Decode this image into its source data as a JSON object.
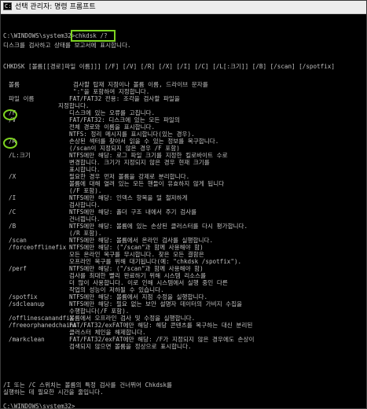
{
  "window": {
    "title": "선택 관리자: 명령 프롬프트",
    "icon": "cmd-icon"
  },
  "console": {
    "command_line": {
      "prompt": "C:\\WINDOWS\\system32>",
      "command": "chkdsk /?"
    },
    "intro": "디스크를 검사하고 상태를 보고서에 표시합니다.",
    "usage": "CHKDSK [볼륨[[경로]파일 이름]]] [/F] [/V] [/R] [/X] [/I] [/C] [/L[:크기]] [/B] [/scan] [/spotfix]",
    "options": [
      {
        "flag": "볼륨",
        "lines": [
          "검사할 탑재 지점이나 볼륨 이름, 드라이브 문자를",
          "\":\"을 포함하여 지정합니다."
        ]
      },
      {
        "flag": "파일 이름",
        "lines": [
          "FAT/FAT32 전용: 조각을 검사할 파일을",
          "지정합니다."
        ]
      },
      {
        "flag": "/F",
        "lines": [
          "디스크에 있는 오류를 고칩니다."
        ]
      },
      {
        "flag": "/V",
        "lines": [
          "FAT/FAT32: 디스크에 있는 모든 파일의",
          "전체 경로와 이름을 표시합니다.",
          "NTFS: 정리 메시지를 표시합니다(있는 경우)."
        ]
      },
      {
        "flag": "/R",
        "lines": [
          "손상된 섹터를 찾아서 읽을 수 있는 정보를 복구합니다.",
          "(/scan이 지정되지 않은 경우 /F 포함)"
        ]
      },
      {
        "flag": "/L:크기",
        "lines": [
          "NTFS에만 해당: 로그 파일 크기를 지정한 킬로바이트 수로",
          "변경합니다. 크기가 지정되지 않은 경우 현재 크기를",
          "표시합니다."
        ]
      },
      {
        "flag": "/X",
        "lines": [
          "필요한 경우 먼저 볼륨을 강제로 분리합니다.",
          "볼륨에 대해 열려 있는 모든 핸들이 유효하지 않게 됩니다",
          "(/F 포함)."
        ]
      },
      {
        "flag": "/I",
        "lines": [
          "NTFS에만 해당: 인덱스 항목을 덜 철저하게",
          "검사합니다."
        ]
      },
      {
        "flag": "/C",
        "lines": [
          "NTFS에만 해당: 폴더 구조 내에서 주기 검사를",
          "건너뜁니다."
        ]
      },
      {
        "flag": "/B",
        "lines": [
          "NTFS에만 해당: 볼륨에 있는 손상된 클러스터를 다시 평가합니다.",
          "(/R 포함)."
        ]
      },
      {
        "flag": "/scan",
        "lines": [
          "NTFS에만 해당: 볼륨에서 온라인 검사를 실행합니다."
        ]
      },
      {
        "flag": "/forceofflinefix",
        "lines": [
          "NTFS에만 해당: (\"/scan\"과 함께 사용해야 함)",
          "모든 온라인 복구를 무시합니다. 찾은 모든 결함은",
          "오프라인 복구를 위해 대기됩니다(예: \"chkdsk /spotfix\")."
        ]
      },
      {
        "flag": "/perf",
        "lines": [
          "NTFS에만 해당: (\"/scan\"과 함께 사용해야 함)",
          "검사를 최대한 빨리 완료하기 위해 시스템 리소스를",
          "더 많이 사용합니다. 이로 인해 시스템에서 실행 중인 다른",
          "작업의 성능이 저하될 수 있습니다."
        ]
      },
      {
        "flag": "/spotfix",
        "lines": [
          "NTFS에만 해당: 볼륨에서 지점 수정을 실행합니다."
        ]
      },
      {
        "flag": "/sdcleanup",
        "lines": [
          "NTFS에만 해당: 필요 없는 보안 설명자 데이터의 가비지 수집을",
          "수행합니다(/F 포함)."
        ]
      },
      {
        "flag": "/offlinescanandfix",
        "lines": [
          "볼륨에서 오프라인 검사 및 수정을 실행합니다."
        ]
      },
      {
        "flag": "/freeorphanedchains",
        "lines": [
          "FAT/FAT32/exFAT에만 해당: 해당 콘텐츠를 복구하는 대신 분리된",
          "클러스터 체인을 해제합니다."
        ]
      },
      {
        "flag": "/markclean",
        "lines": [
          "FAT/FAT32/exFAT에만 해당: /F가 지정되지 않은 경우에도 손상이",
          "검색되지 않으면 볼륨을 정상으로 표시합니다."
        ]
      }
    ],
    "footer": [
      "/I 또는 /C 스위치는 볼륨의 특정 검사를 건너뛰어 Chkdsk를",
      "실행하는 데 필요한 시간을 줄입니다."
    ],
    "final_prompt": "C:\\WINDOWS\\system32>"
  },
  "annotations": {
    "color": "#7ed321"
  }
}
